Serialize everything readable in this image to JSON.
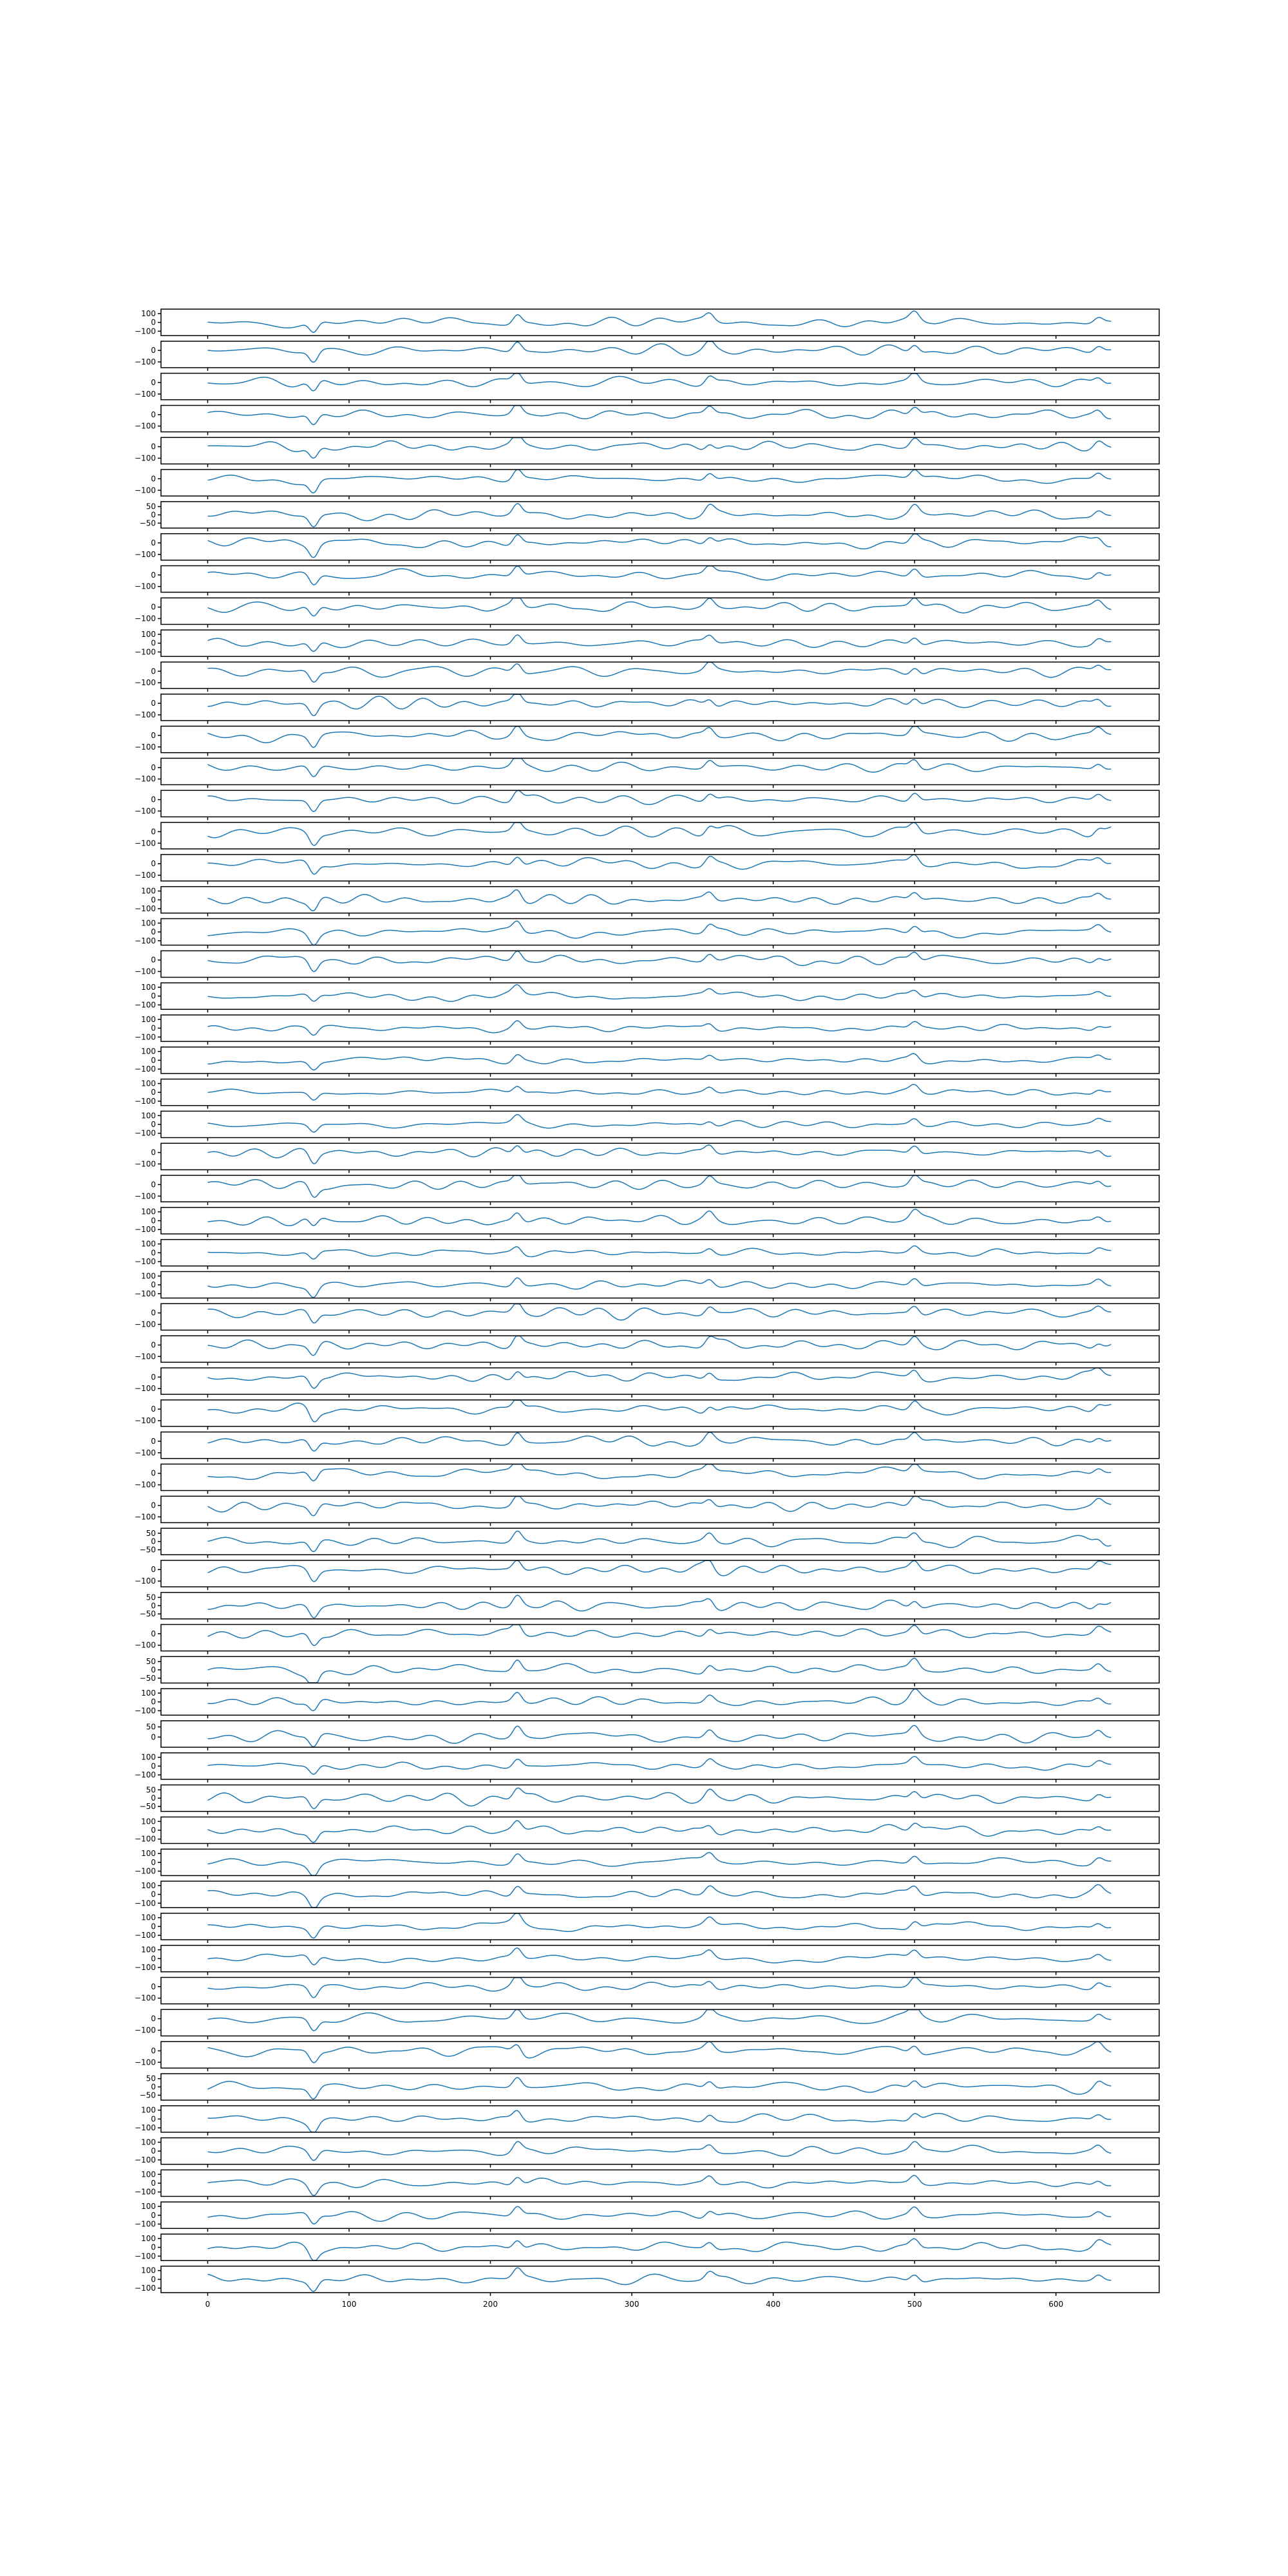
{
  "chart_data": {
    "type": "line",
    "layout": "62 vertically stacked line subplots sharing one x axis",
    "series_color": "#1f77b4",
    "grid": false,
    "legend": "none",
    "title": "",
    "xlabel": "",
    "ylabel": "",
    "xlim": [
      -33,
      673
    ],
    "x_ticks": [
      0,
      100,
      200,
      300,
      400,
      500,
      600
    ],
    "x_tick_labels": [
      "0",
      "100",
      "200",
      "300",
      "400",
      "500",
      "600"
    ],
    "n_samples": 640,
    "common_events": [
      {
        "x": 75,
        "value": -110
      },
      {
        "x": 219,
        "value": 95
      },
      {
        "x": 355,
        "value": 70
      },
      {
        "x": 500,
        "value": 80
      },
      {
        "x": 630,
        "value": 55
      }
    ],
    "subplots": [
      {
        "y_ticks": [
          100,
          0,
          -100
        ],
        "y_tick_labels": [
          "100",
          "0",
          "−100"
        ],
        "ylim": [
          -150,
          150
        ],
        "amplitude": 60
      },
      {
        "y_ticks": [
          0,
          -100
        ],
        "y_tick_labels": [
          "0",
          "−100"
        ],
        "ylim": [
          -150,
          80
        ],
        "amplitude": 50
      },
      {
        "y_ticks": [
          0,
          -100
        ],
        "y_tick_labels": [
          "0",
          "−100"
        ],
        "ylim": [
          -150,
          80
        ],
        "amplitude": 50
      },
      {
        "y_ticks": [
          0,
          -100
        ],
        "y_tick_labels": [
          "0",
          "−100"
        ],
        "ylim": [
          -150,
          80
        ],
        "amplitude": 50
      },
      {
        "y_ticks": [
          0,
          -100
        ],
        "y_tick_labels": [
          "0",
          "−100"
        ],
        "ylim": [
          -150,
          80
        ],
        "amplitude": 50
      },
      {
        "y_ticks": [
          0,
          -100
        ],
        "y_tick_labels": [
          "0",
          "−100"
        ],
        "ylim": [
          -150,
          80
        ],
        "amplitude": 50
      },
      {
        "y_ticks": [
          50,
          0,
          -50
        ],
        "y_tick_labels": [
          "50",
          "0",
          "−50"
        ],
        "ylim": [
          -80,
          80
        ],
        "amplitude": 35
      },
      {
        "y_ticks": [
          0,
          -100
        ],
        "y_tick_labels": [
          "0",
          "−100"
        ],
        "ylim": [
          -150,
          80
        ],
        "amplitude": 50
      },
      {
        "y_ticks": [
          0,
          -100
        ],
        "y_tick_labels": [
          "0",
          "−100"
        ],
        "ylim": [
          -150,
          80
        ],
        "amplitude": 50
      },
      {
        "y_ticks": [
          0,
          -100
        ],
        "y_tick_labels": [
          "0",
          "−100"
        ],
        "ylim": [
          -150,
          80
        ],
        "amplitude": 50
      },
      {
        "y_ticks": [
          100,
          0,
          -100
        ],
        "y_tick_labels": [
          "100",
          "0",
          "−100"
        ],
        "ylim": [
          -150,
          150
        ],
        "amplitude": 60
      },
      {
        "y_ticks": [
          0,
          -100
        ],
        "y_tick_labels": [
          "0",
          "−100"
        ],
        "ylim": [
          -150,
          80
        ],
        "amplitude": 50
      },
      {
        "y_ticks": [
          0,
          -100
        ],
        "y_tick_labels": [
          "0",
          "−100"
        ],
        "ylim": [
          -150,
          80
        ],
        "amplitude": 50
      },
      {
        "y_ticks": [
          0,
          -100
        ],
        "y_tick_labels": [
          "0",
          "−100"
        ],
        "ylim": [
          -150,
          80
        ],
        "amplitude": 50
      },
      {
        "y_ticks": [
          0,
          -100
        ],
        "y_tick_labels": [
          "0",
          "−100"
        ],
        "ylim": [
          -150,
          80
        ],
        "amplitude": 50
      },
      {
        "y_ticks": [
          0,
          -100
        ],
        "y_tick_labels": [
          "0",
          "−100"
        ],
        "ylim": [
          -150,
          80
        ],
        "amplitude": 50
      },
      {
        "y_ticks": [
          0,
          -100
        ],
        "y_tick_labels": [
          "0",
          "−100"
        ],
        "ylim": [
          -150,
          80
        ],
        "amplitude": 50
      },
      {
        "y_ticks": [
          0,
          -100
        ],
        "y_tick_labels": [
          "0",
          "−100"
        ],
        "ylim": [
          -150,
          80
        ],
        "amplitude": 50
      },
      {
        "y_ticks": [
          100,
          0,
          -100
        ],
        "y_tick_labels": [
          "100",
          "0",
          "−100"
        ],
        "ylim": [
          -150,
          150
        ],
        "amplitude": 60
      },
      {
        "y_ticks": [
          100,
          0,
          -100
        ],
        "y_tick_labels": [
          "100",
          "0",
          "−100"
        ],
        "ylim": [
          -150,
          150
        ],
        "amplitude": 60
      },
      {
        "y_ticks": [
          0,
          -100
        ],
        "y_tick_labels": [
          "0",
          "−100"
        ],
        "ylim": [
          -150,
          80
        ],
        "amplitude": 50
      },
      {
        "y_ticks": [
          100,
          0,
          -100
        ],
        "y_tick_labels": [
          "100",
          "0",
          "−100"
        ],
        "ylim": [
          -150,
          150
        ],
        "amplitude": 45
      },
      {
        "y_ticks": [
          100,
          0,
          -100
        ],
        "y_tick_labels": [
          "100",
          "0",
          "−100"
        ],
        "ylim": [
          -150,
          150
        ],
        "amplitude": 45
      },
      {
        "y_ticks": [
          100,
          0,
          -100
        ],
        "y_tick_labels": [
          "100",
          "0",
          "−100"
        ],
        "ylim": [
          -150,
          150
        ],
        "amplitude": 45
      },
      {
        "y_ticks": [
          100,
          0,
          -100
        ],
        "y_tick_labels": [
          "100",
          "0",
          "−100"
        ],
        "ylim": [
          -150,
          150
        ],
        "amplitude": 45
      },
      {
        "y_ticks": [
          100,
          0,
          -100
        ],
        "y_tick_labels": [
          "100",
          "0",
          "−100"
        ],
        "ylim": [
          -150,
          150
        ],
        "amplitude": 45
      },
      {
        "y_ticks": [
          0,
          -100
        ],
        "y_tick_labels": [
          "0",
          "−100"
        ],
        "ylim": [
          -150,
          80
        ],
        "amplitude": 50
      },
      {
        "y_ticks": [
          0,
          -100
        ],
        "y_tick_labels": [
          "0",
          "−100"
        ],
        "ylim": [
          -150,
          80
        ],
        "amplitude": 50
      },
      {
        "y_ticks": [
          100,
          0,
          -100
        ],
        "y_tick_labels": [
          "100",
          "0",
          "−100"
        ],
        "ylim": [
          -150,
          150
        ],
        "amplitude": 60
      },
      {
        "y_ticks": [
          100,
          0,
          -100
        ],
        "y_tick_labels": [
          "100",
          "0",
          "−100"
        ],
        "ylim": [
          -150,
          150
        ],
        "amplitude": 45
      },
      {
        "y_ticks": [
          100,
          0,
          -100
        ],
        "y_tick_labels": [
          "100",
          "0",
          "−100"
        ],
        "ylim": [
          -150,
          150
        ],
        "amplitude": 60
      },
      {
        "y_ticks": [
          0,
          -100
        ],
        "y_tick_labels": [
          "0",
          "−100"
        ],
        "ylim": [
          -150,
          80
        ],
        "amplitude": 50
      },
      {
        "y_ticks": [
          0,
          -100
        ],
        "y_tick_labels": [
          "0",
          "−100"
        ],
        "ylim": [
          -150,
          80
        ],
        "amplitude": 50
      },
      {
        "y_ticks": [
          0,
          -100
        ],
        "y_tick_labels": [
          "0",
          "−100"
        ],
        "ylim": [
          -150,
          80
        ],
        "amplitude": 50
      },
      {
        "y_ticks": [
          0,
          -100
        ],
        "y_tick_labels": [
          "0",
          "−100"
        ],
        "ylim": [
          -150,
          80
        ],
        "amplitude": 50
      },
      {
        "y_ticks": [
          0,
          -100
        ],
        "y_tick_labels": [
          "0",
          "−100"
        ],
        "ylim": [
          -150,
          80
        ],
        "amplitude": 50
      },
      {
        "y_ticks": [
          0,
          -100
        ],
        "y_tick_labels": [
          "0",
          "−100"
        ],
        "ylim": [
          -150,
          80
        ],
        "amplitude": 50
      },
      {
        "y_ticks": [
          0,
          -100
        ],
        "y_tick_labels": [
          "0",
          "−100"
        ],
        "ylim": [
          -150,
          80
        ],
        "amplitude": 50
      },
      {
        "y_ticks": [
          50,
          0,
          -50
        ],
        "y_tick_labels": [
          "50",
          "0",
          "−50"
        ],
        "ylim": [
          -80,
          80
        ],
        "amplitude": 35
      },
      {
        "y_ticks": [
          0,
          -100
        ],
        "y_tick_labels": [
          "0",
          "−100"
        ],
        "ylim": [
          -150,
          80
        ],
        "amplitude": 50
      },
      {
        "y_ticks": [
          50,
          0,
          -50
        ],
        "y_tick_labels": [
          "50",
          "0",
          "−50"
        ],
        "ylim": [
          -80,
          80
        ],
        "amplitude": 35
      },
      {
        "y_ticks": [
          0,
          -100
        ],
        "y_tick_labels": [
          "0",
          "−100"
        ],
        "ylim": [
          -150,
          80
        ],
        "amplitude": 50
      },
      {
        "y_ticks": [
          50,
          0,
          -50
        ],
        "y_tick_labels": [
          "50",
          "0",
          "−50"
        ],
        "ylim": [
          -80,
          80
        ],
        "amplitude": 40
      },
      {
        "y_ticks": [
          100,
          0,
          -100
        ],
        "y_tick_labels": [
          "100",
          "0",
          "−100"
        ],
        "ylim": [
          -150,
          150
        ],
        "amplitude": 60
      },
      {
        "y_ticks": [
          50,
          0
        ],
        "y_tick_labels": [
          "50",
          "0"
        ],
        "ylim": [
          -50,
          80
        ],
        "amplitude": 30
      },
      {
        "y_ticks": [
          100,
          0,
          -100
        ],
        "y_tick_labels": [
          "100",
          "0",
          "−100"
        ],
        "ylim": [
          -150,
          150
        ],
        "amplitude": 55
      },
      {
        "y_ticks": [
          50,
          0,
          -50
        ],
        "y_tick_labels": [
          "50",
          "0",
          "−50"
        ],
        "ylim": [
          -80,
          80
        ],
        "amplitude": 35
      },
      {
        "y_ticks": [
          100,
          0,
          -100
        ],
        "y_tick_labels": [
          "100",
          "0",
          "−100"
        ],
        "ylim": [
          -150,
          150
        ],
        "amplitude": 60
      },
      {
        "y_ticks": [
          100,
          0,
          -100
        ],
        "y_tick_labels": [
          "100",
          "0",
          "−100"
        ],
        "ylim": [
          -150,
          150
        ],
        "amplitude": 60
      },
      {
        "y_ticks": [
          100,
          0,
          -100
        ],
        "y_tick_labels": [
          "100",
          "0",
          "−100"
        ],
        "ylim": [
          -150,
          150
        ],
        "amplitude": 60
      },
      {
        "y_ticks": [
          100,
          0,
          -100
        ],
        "y_tick_labels": [
          "100",
          "0",
          "−100"
        ],
        "ylim": [
          -150,
          150
        ],
        "amplitude": 60
      },
      {
        "y_ticks": [
          100,
          0,
          -100
        ],
        "y_tick_labels": [
          "100",
          "0",
          "−100"
        ],
        "ylim": [
          -150,
          150
        ],
        "amplitude": 60
      },
      {
        "y_ticks": [
          0,
          -100
        ],
        "y_tick_labels": [
          "0",
          "−100"
        ],
        "ylim": [
          -150,
          80
        ],
        "amplitude": 50
      },
      {
        "y_ticks": [
          0,
          -100
        ],
        "y_tick_labels": [
          "0",
          "−100"
        ],
        "ylim": [
          -150,
          80
        ],
        "amplitude": 50
      },
      {
        "y_ticks": [
          0,
          -100
        ],
        "y_tick_labels": [
          "0",
          "−100"
        ],
        "ylim": [
          -150,
          80
        ],
        "amplitude": 50
      },
      {
        "y_ticks": [
          50,
          0,
          -50
        ],
        "y_tick_labels": [
          "50",
          "0",
          "−50"
        ],
        "ylim": [
          -80,
          80
        ],
        "amplitude": 35
      },
      {
        "y_ticks": [
          100,
          0,
          -100
        ],
        "y_tick_labels": [
          "100",
          "0",
          "−100"
        ],
        "ylim": [
          -150,
          150
        ],
        "amplitude": 60
      },
      {
        "y_ticks": [
          100,
          0,
          -100
        ],
        "y_tick_labels": [
          "100",
          "0",
          "−100"
        ],
        "ylim": [
          -150,
          150
        ],
        "amplitude": 60
      },
      {
        "y_ticks": [
          100,
          0,
          -100
        ],
        "y_tick_labels": [
          "100",
          "0",
          "−100"
        ],
        "ylim": [
          -150,
          150
        ],
        "amplitude": 60
      },
      {
        "y_ticks": [
          100,
          0,
          -100
        ],
        "y_tick_labels": [
          "100",
          "0",
          "−100"
        ],
        "ylim": [
          -150,
          150
        ],
        "amplitude": 60
      },
      {
        "y_ticks": [
          100,
          0,
          -100
        ],
        "y_tick_labels": [
          "100",
          "0",
          "−100"
        ],
        "ylim": [
          -150,
          150
        ],
        "amplitude": 60
      },
      {
        "y_ticks": [
          100,
          0,
          -100
        ],
        "y_tick_labels": [
          "100",
          "0",
          "−100"
        ],
        "ylim": [
          -150,
          150
        ],
        "amplitude": 60
      }
    ]
  }
}
